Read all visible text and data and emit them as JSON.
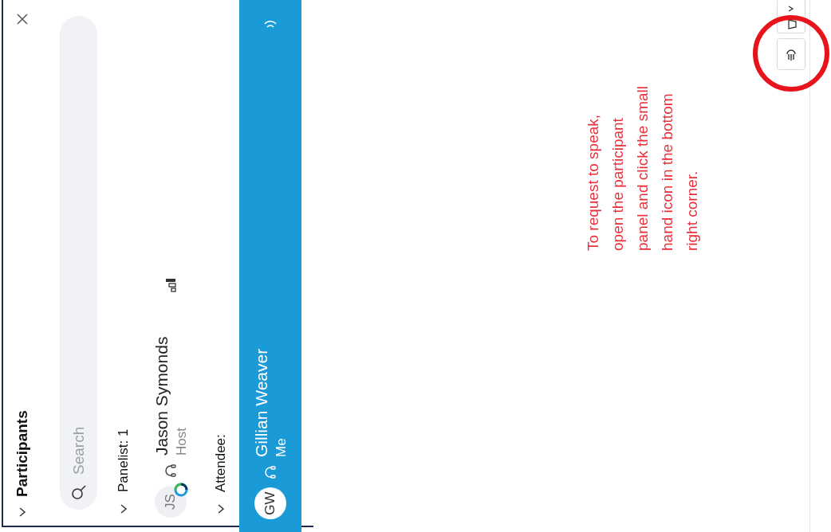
{
  "panel": {
    "title": "Participants",
    "search": {
      "placeholder": "Search"
    },
    "groups": [
      {
        "label": "Panelist: 1",
        "expanded": true,
        "members": [
          {
            "initials": "JS",
            "name": "Jason Symonds",
            "role": "Host",
            "selected": false,
            "presenting": true
          }
        ]
      },
      {
        "label": "Attendee:",
        "expanded": true,
        "members": [
          {
            "initials": "GW",
            "name": "Gillian Weaver",
            "role": "Me",
            "selected": true,
            "presenting": false
          }
        ]
      }
    ]
  },
  "note": {
    "lines": [
      "To request to speak,",
      "open the participant",
      "panel and click the small",
      "hand icon in the bottom",
      "right corner."
    ]
  }
}
